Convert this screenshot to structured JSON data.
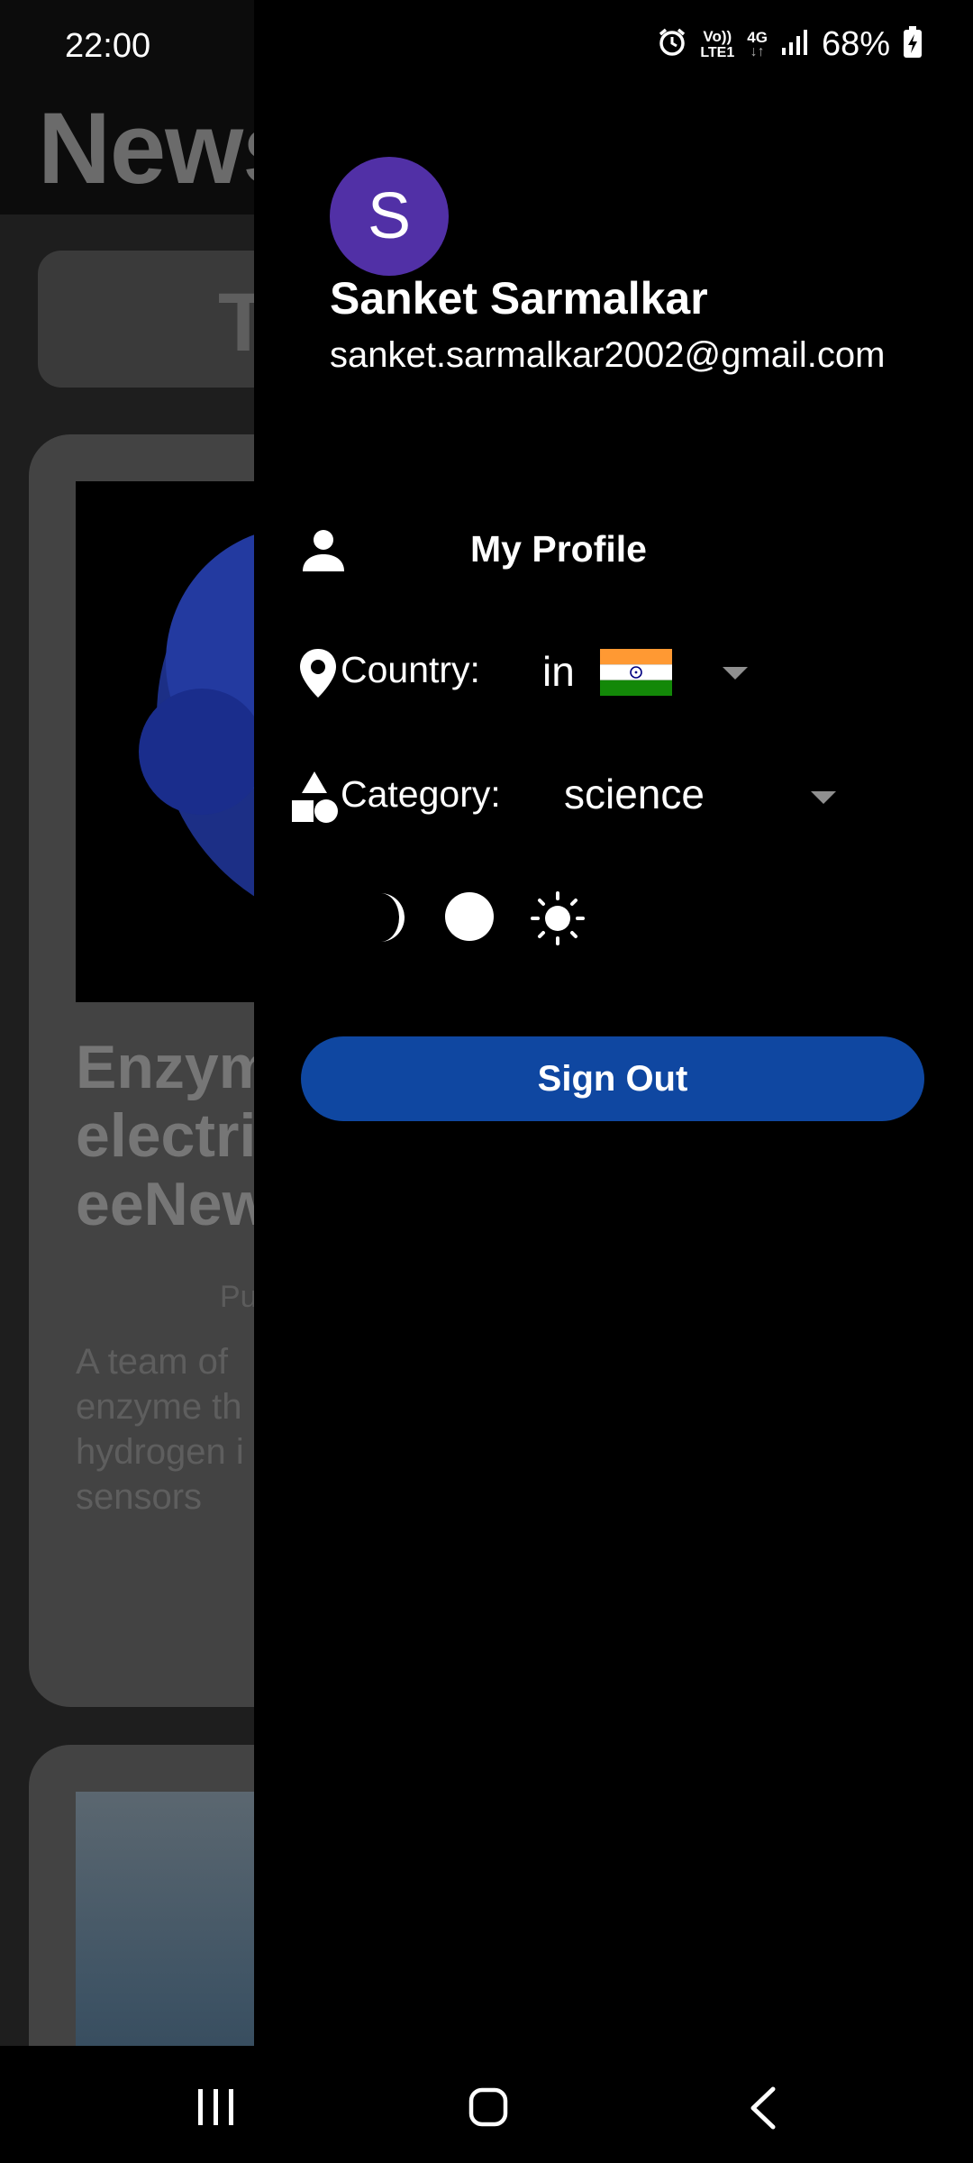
{
  "status_bar": {
    "time": "22:00",
    "network_volte": "Vo))",
    "network_lte": "LTE1",
    "network_type": "4G",
    "battery": "68%"
  },
  "background_app": {
    "title": "News",
    "tab_label": "T",
    "article": {
      "title": "Enzym\nelectri\neeNew",
      "published": "Pu",
      "description": "A team of\nenzyme th\nhydrogen i\nsensors"
    }
  },
  "drawer": {
    "avatar_initial": "S",
    "user_name": "Sanket Sarmalkar",
    "user_email": "sanket.sarmalkar2002@gmail.com",
    "profile_label": "My Profile",
    "country_label": "Country:",
    "country_value": "in",
    "category_label": "Category:",
    "category_value": "science",
    "theme_toggle": {
      "state": "light"
    },
    "sign_out_label": "Sign Out"
  },
  "colors": {
    "avatar": "#5130a6",
    "sign_out_button": "#0f47a1",
    "drawer_background": "#000000"
  },
  "icons": [
    "alarm-icon",
    "signal-icon",
    "battery-charging-icon",
    "person-icon",
    "location-pin-icon",
    "india-flag-icon",
    "shapes-icon",
    "moon-icon",
    "sun-icon",
    "recents-icon",
    "home-icon",
    "back-icon"
  ]
}
